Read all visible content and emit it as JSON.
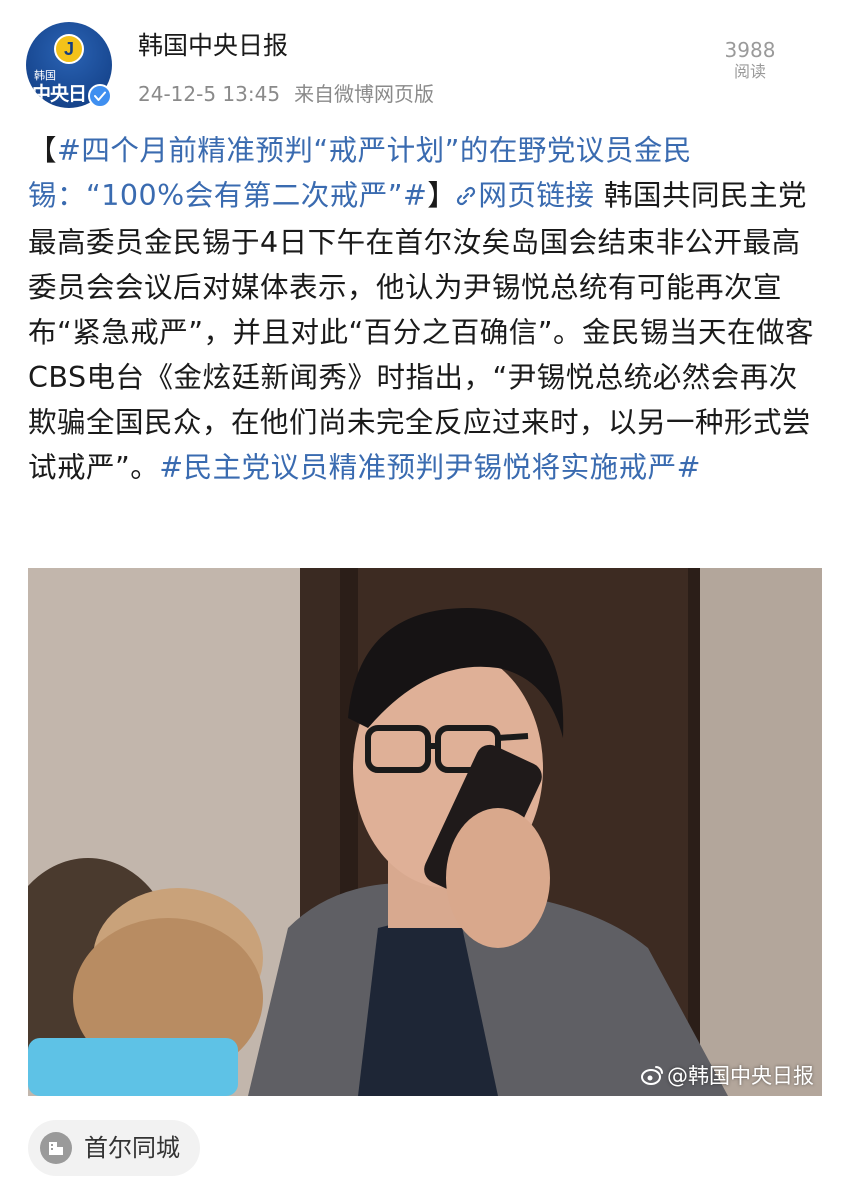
{
  "header": {
    "avatar_logo_small": "韩国",
    "avatar_logo_big": "中央日",
    "avatar_badge_letter": "J",
    "account_name": "韩国中央日报",
    "timestamp": "24-12-5 13:45",
    "source": "来自微博网页版",
    "read_count": "3988",
    "read_label": "阅读",
    "verified_icon": "verified-v-icon"
  },
  "post": {
    "topic_open": "【",
    "topic_hashtag": "#四个月前精准预判“戒严计划”的在野党议员金民锡：“100%会有第二次戒严”#",
    "topic_close": "】",
    "link_icon": "link-icon",
    "link_label": "网页链接",
    "body": " 韩国共同民主党最高委员金民锡于4日下午在首尔汝矣岛国会结束非公开最高委员会会议后对媒体表示，他认为尹锡悦总统有可能再次宣布“紧急戒严”，并且对此“百分之百确信”。金民锡当天在做客CBS电台《金炫廷新闻秀》时指出，“尹锡悦总统必然会再次欺骗全国民众，在他们尚未完全反应过来时，以另一种形式尝试戒严”。",
    "trailing_hashtag": "#民主党议员精准预判尹锡悦将实施戒严#"
  },
  "photo": {
    "watermark": "@韩国中央日报",
    "watermark_icon": "weibo-logo-icon"
  },
  "location": {
    "label": "首尔同城",
    "icon": "location-building-icon"
  },
  "colors": {
    "link_blue": "#3a6bb0",
    "meta_gray": "#8a8a8a",
    "verified_blue": "#3f8ff0",
    "avatar_navy": "#17468f",
    "badge_yellow": "#f3c21a"
  }
}
